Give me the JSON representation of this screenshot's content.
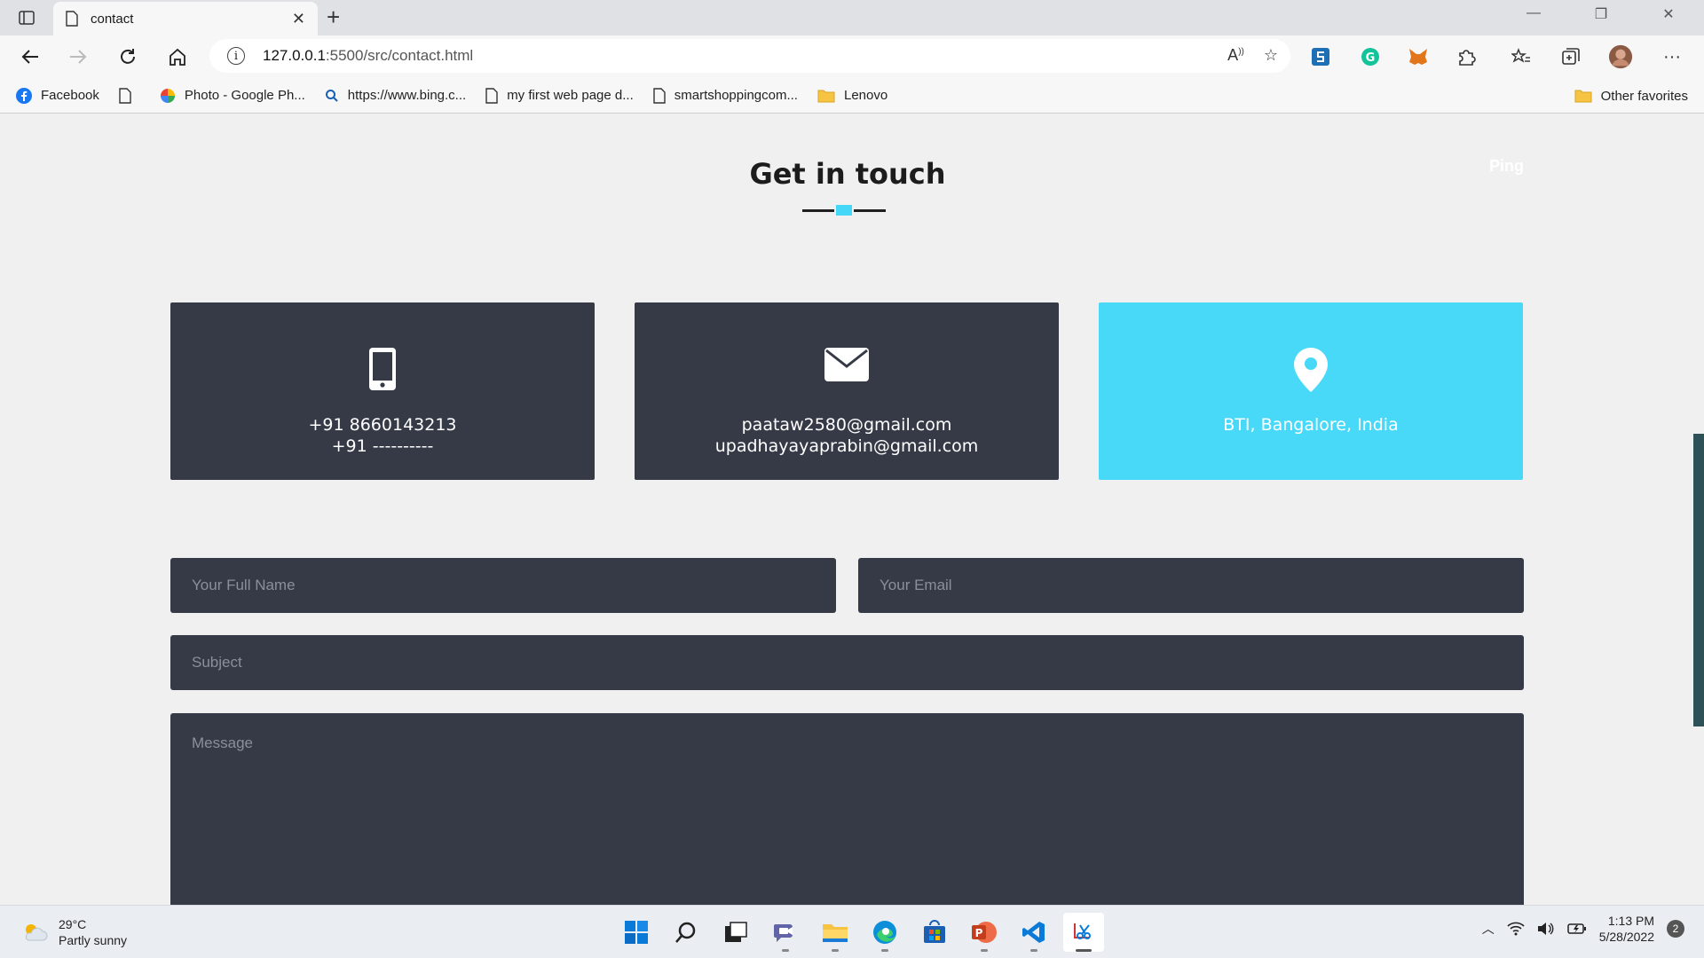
{
  "browser": {
    "tab_title": "contact",
    "url_host": "127.0.0.1",
    "url_path": ":5500/src/contact.html",
    "bookmarks": [
      {
        "label": "Facebook",
        "icon": "facebook-icon"
      },
      {
        "label": "",
        "icon": "page-icon"
      },
      {
        "label": "Photo - Google Ph...",
        "icon": "google-photos-icon"
      },
      {
        "label": "https://www.bing.c...",
        "icon": "search-icon"
      },
      {
        "label": "my first web page d...",
        "icon": "page-icon"
      },
      {
        "label": "smartshoppingcom...",
        "icon": "page-icon"
      },
      {
        "label": "Lenovo",
        "icon": "folder-icon"
      }
    ],
    "other_favorites": "Other favorites"
  },
  "page": {
    "heading": "Get in touch",
    "ping_label": "Ping",
    "accent_color": "#48d8f8",
    "card_color": "#363a47",
    "cards": [
      {
        "icon": "phone-icon",
        "line1": "+91 8660143213",
        "line2": "+91 ----------"
      },
      {
        "icon": "envelope-icon",
        "line1": "paataw2580@gmail.com",
        "line2": "upadhayayaprabin@gmail.com"
      },
      {
        "icon": "location-pin-icon",
        "line1": "BTI, Bangalore, India",
        "line2": ""
      }
    ],
    "form": {
      "name_placeholder": "Your Full Name",
      "email_placeholder": "Your Email",
      "subject_placeholder": "Subject",
      "message_placeholder": "Message"
    }
  },
  "taskbar": {
    "temperature": "29°C",
    "weather": "Partly sunny",
    "time": "1:13 PM",
    "date": "5/28/2022",
    "notifications": "2"
  }
}
